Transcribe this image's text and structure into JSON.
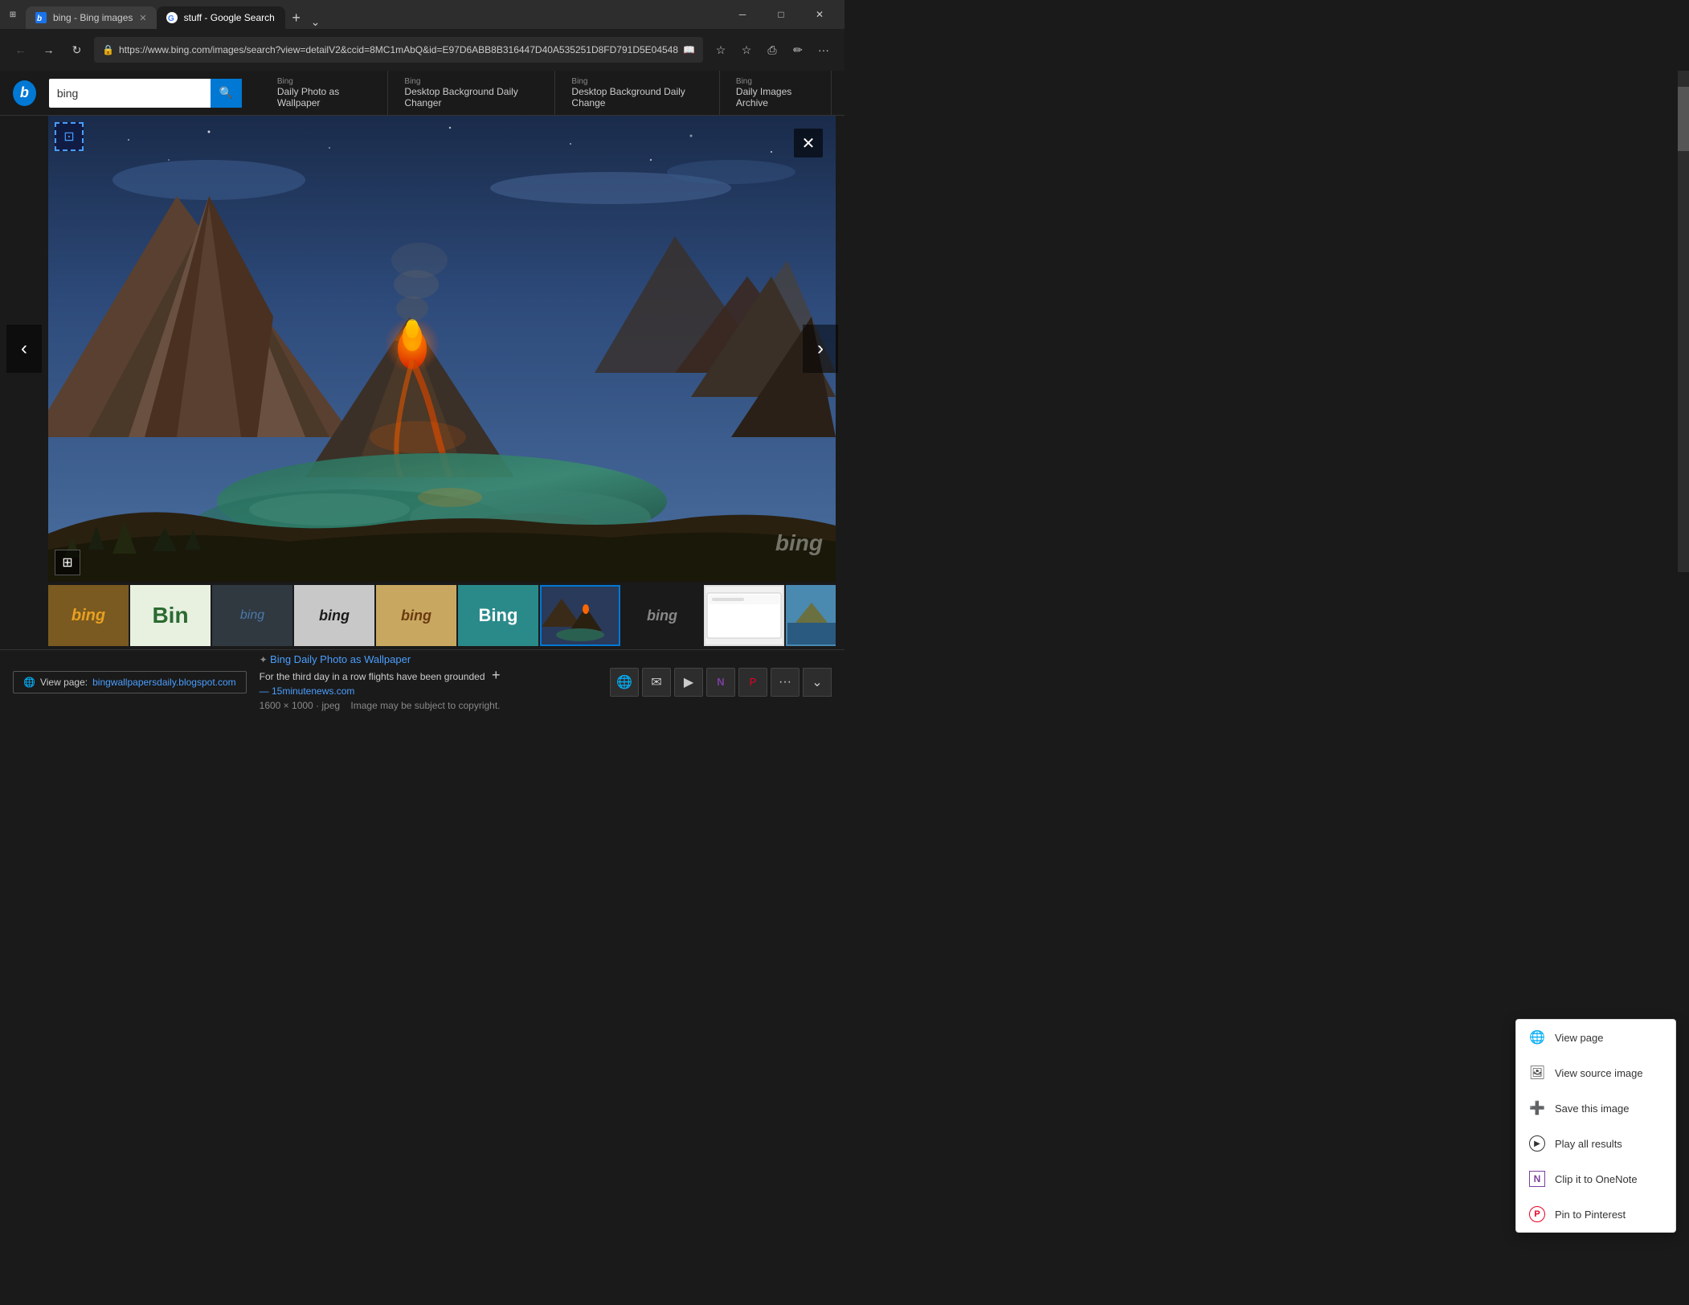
{
  "browser": {
    "tabs": [
      {
        "id": "tab-bing",
        "label": "bing - Bing images",
        "favicon": "bing",
        "active": false
      },
      {
        "id": "tab-google",
        "label": "stuff - Google Search",
        "favicon": "google",
        "active": true
      }
    ],
    "url": "https://www.bing.com/images/search?view=detailV2&ccid=8MC1mAbQ&id=E97D6ABB8B316447D40A535251D8FD791D5E04548",
    "window_controls": {
      "minimize": "─",
      "maximize": "□",
      "close": "✕"
    }
  },
  "bing": {
    "logo_letter": "b",
    "search_value": "bing",
    "search_placeholder": "bing",
    "nav_items": [
      {
        "sub": "Bing",
        "main": "Daily Photo as Wallpaper"
      },
      {
        "sub": "Bing",
        "main": "Desktop Background Daily Changer"
      },
      {
        "sub": "Bing",
        "main": "Desktop Background Daily Change"
      },
      {
        "sub": "Bing",
        "main": "Daily Images Archive"
      }
    ]
  },
  "image_info": {
    "dimensions": "1600 × 1000 · jpeg",
    "copyright": "Image may be subject to copyright.",
    "watermark": "bing"
  },
  "footer": {
    "view_page_label": "View page:",
    "view_page_url": "bingwallpapersdaily.blogspot.com",
    "source_title": "Bing Daily Photo as Wallpaper",
    "source_desc": "For the third day in a row flights have been grounded",
    "source_url": "— 15minutenews.com"
  },
  "context_menu": {
    "items": [
      {
        "id": "view-page",
        "label": "View page",
        "icon": "🌐"
      },
      {
        "id": "view-source",
        "label": "View source image",
        "icon": "🖼"
      },
      {
        "id": "save-image",
        "label": "Save this image",
        "icon": "➕"
      },
      {
        "id": "play-all",
        "label": "Play all results",
        "icon": "▶"
      },
      {
        "id": "clip-onenote",
        "label": "Clip it to OneNote",
        "icon": "N"
      },
      {
        "id": "pin-pinterest",
        "label": "Pin to Pinterest",
        "icon": "P"
      }
    ]
  }
}
